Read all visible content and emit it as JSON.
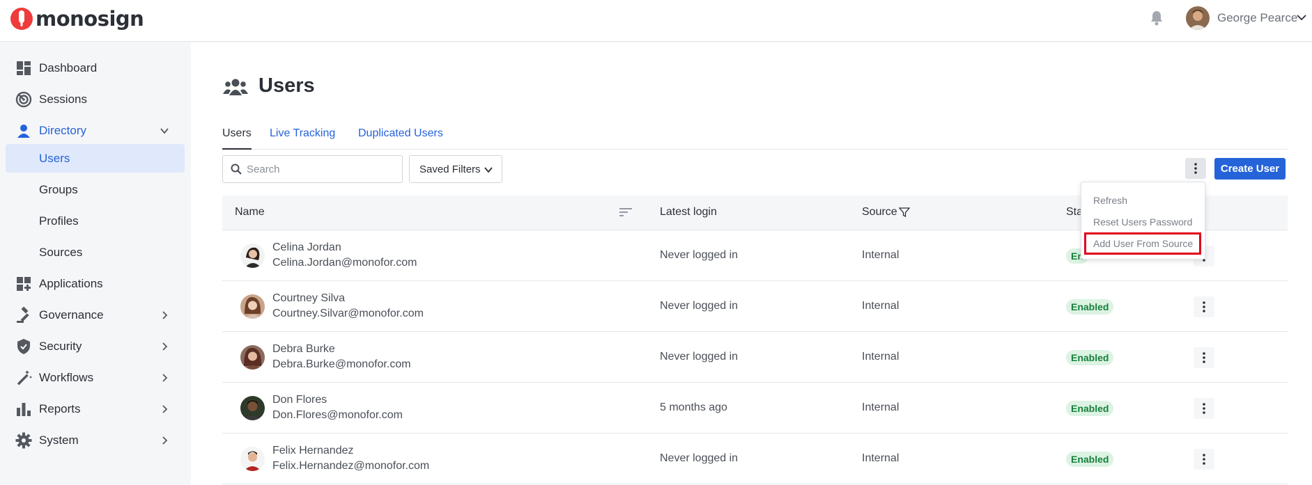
{
  "header": {
    "brand": "monosign",
    "user_name": "George Pearce",
    "icons": {
      "bell": "bell-icon",
      "menu": "chevron-down-icon"
    }
  },
  "sidebar": {
    "items": [
      {
        "label": "Dashboard",
        "icon": "dashboard-icon"
      },
      {
        "label": "Sessions",
        "icon": "sessions-icon"
      },
      {
        "label": "Directory",
        "icon": "user-icon"
      },
      {
        "label": "Users"
      },
      {
        "label": "Groups"
      },
      {
        "label": "Profiles"
      },
      {
        "label": "Sources"
      },
      {
        "label": "Applications",
        "icon": "applications-icon"
      },
      {
        "label": "Governance",
        "icon": "gavel-icon"
      },
      {
        "label": "Security",
        "icon": "shield-icon"
      },
      {
        "label": "Workflows",
        "icon": "magic-wand-icon"
      },
      {
        "label": "Reports",
        "icon": "bar-chart-icon"
      },
      {
        "label": "System",
        "icon": "gear-icon"
      }
    ]
  },
  "page": {
    "title": "Users",
    "tabs": [
      "Users",
      "Live Tracking",
      "Duplicated Users"
    ]
  },
  "toolbar": {
    "search_placeholder": "Search",
    "saved_filters_label": "Saved Filters",
    "create_label": "Create User"
  },
  "table": {
    "columns": [
      "Name",
      "Latest login",
      "Source",
      "Sta"
    ],
    "rows": [
      {
        "name": "Celina Jordan",
        "email": "Celina.Jordan@monofor.com",
        "latest_login": "Never logged in",
        "source": "Internal",
        "status": "En"
      },
      {
        "name": "Courtney Silva",
        "email": "Courtney.Silvar@monofor.com",
        "latest_login": "Never logged in",
        "source": "Internal",
        "status": "Enabled"
      },
      {
        "name": "Debra Burke",
        "email": "Debra.Burke@monofor.com",
        "latest_login": "Never logged in",
        "source": "Internal",
        "status": "Enabled"
      },
      {
        "name": "Don Flores",
        "email": "Don.Flores@monofor.com",
        "latest_login": "5 months ago",
        "source": "Internal",
        "status": "Enabled"
      },
      {
        "name": "Felix Hernandez",
        "email": "Felix.Hernandez@monofor.com",
        "latest_login": "Never logged in",
        "source": "Internal",
        "status": "Enabled"
      }
    ]
  },
  "dropdown": {
    "items": [
      "Refresh",
      "Reset Users Password",
      "Add User From Source"
    ]
  },
  "colors": {
    "accent": "#2563d9",
    "badge_bg": "#dcf3e3",
    "badge_text": "#17803b",
    "highlight": "#e0001b"
  }
}
